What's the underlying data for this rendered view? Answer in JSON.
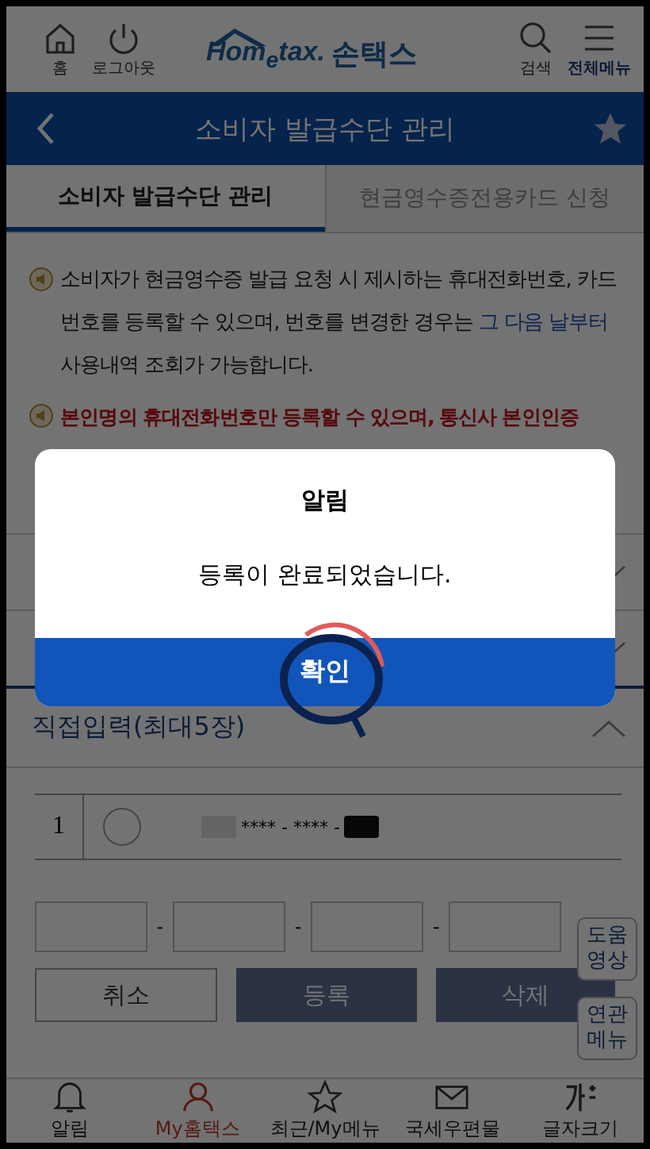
{
  "header": {
    "home_label": "홈",
    "logout_label": "로그아웃",
    "logo": "Hom$_{e}$tax.",
    "logo_suffix": "손택스",
    "search_label": "검색",
    "menu_label": "전체메뉴"
  },
  "title_bar": {
    "title": "소비자 발급수단 관리"
  },
  "tabs": [
    {
      "label": "소비자 발급수단 관리",
      "selected": true
    },
    {
      "label": "현금영수증전용카드 신청",
      "selected": false
    }
  ],
  "notices": [
    {
      "kind": "info",
      "text": "소비자가 현금영수증 발급 요청 시 제시하는 휴대전화번호, 카드번호를 등록할 수 있으며, 번호를 변경한 경우는 ",
      "link": "그 다음 날부터",
      "text_after": " 사용내역 조회가 가능합니다."
    },
    {
      "kind": "warning",
      "text": "본인명의 휴대전화번호만 등록할 수 있으며, 통신사 본인인증"
    }
  ],
  "sections": [
    {
      "expanded": false
    },
    {
      "expanded": false
    },
    {
      "title": "직접입력(최대5장)",
      "expanded": true
    }
  ],
  "entries": [
    {
      "index": "1",
      "selected": false,
      "masked_number": "**** - **** -"
    }
  ],
  "input_separators": [
    "-",
    "-",
    "-"
  ],
  "buttons": [
    {
      "label": "취소",
      "kind": "secondary"
    },
    {
      "label": "등록",
      "kind": "primary"
    },
    {
      "label": "삭제",
      "kind": "primary"
    }
  ],
  "floating_buttons": [
    {
      "lines": [
        "도움",
        "영상"
      ]
    },
    {
      "lines": [
        "연관",
        "메뉴"
      ]
    }
  ],
  "bottom_nav": [
    {
      "label": "알림",
      "kind": "bell",
      "selected": false
    },
    {
      "label": "My홈택스",
      "kind": "person",
      "selected": true
    },
    {
      "label": "최근/My메뉴",
      "kind": "star",
      "selected": false
    },
    {
      "label": "국세우편물",
      "kind": "mail",
      "selected": false
    },
    {
      "label": "글자크기",
      "kind": "textsize",
      "selected": false
    }
  ],
  "dialog": {
    "title": "알림",
    "message": "등록이 완료되었습니다.",
    "button": "확인"
  }
}
